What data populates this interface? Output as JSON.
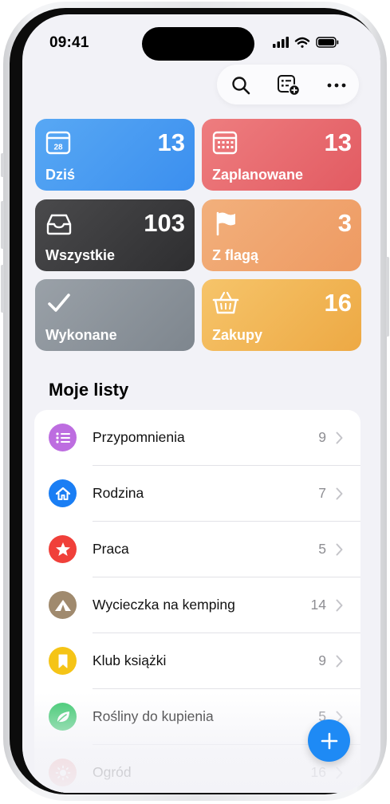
{
  "status_bar": {
    "time": "09:41"
  },
  "toolbar": {
    "icons": [
      "search-icon",
      "list-add-icon",
      "more-icon"
    ]
  },
  "smart_lists": [
    {
      "id": "today",
      "label": "Dziś",
      "count": "13",
      "icon": "calendar-icon",
      "calendar_day": "28",
      "color": "#3b94f0"
    },
    {
      "id": "scheduled",
      "label": "Zaplanowane",
      "count": "13",
      "icon": "calendar-grid-icon",
      "color": "#e9696d"
    },
    {
      "id": "all",
      "label": "Wszystkie",
      "count": "103",
      "icon": "tray-icon",
      "color": "#3a3a3c"
    },
    {
      "id": "flagged",
      "label": "Z flagą",
      "count": "3",
      "icon": "flag-icon",
      "color": "#f0a36a"
    },
    {
      "id": "completed",
      "label": "Wykonane",
      "count": "",
      "icon": "checkmark-icon",
      "color": "#8e959c"
    },
    {
      "id": "shopping",
      "label": "Zakupy",
      "count": "16",
      "icon": "basket-icon",
      "color": "#f2b652"
    }
  ],
  "my_lists": {
    "title": "Moje listy",
    "items": [
      {
        "name": "Przypomnienia",
        "count": "9",
        "icon": "list-icon",
        "color": "#bd6de0"
      },
      {
        "name": "Rodzina",
        "count": "7",
        "icon": "house-icon",
        "color": "#1a7ef4"
      },
      {
        "name": "Praca",
        "count": "5",
        "icon": "star-icon",
        "color": "#f0403a"
      },
      {
        "name": "Wycieczka na kemping",
        "count": "14",
        "icon": "tent-icon",
        "color": "#a08a6e"
      },
      {
        "name": "Klub książki",
        "count": "9",
        "icon": "bookmark-icon",
        "color": "#f5c417"
      },
      {
        "name": "Rośliny do kupienia",
        "count": "5",
        "icon": "leaf-icon",
        "color": "#37c76a"
      },
      {
        "name": "Ogród",
        "count": "16",
        "icon": "sun-icon",
        "color": "#f0a0a0"
      }
    ]
  },
  "fab": {
    "icon": "plus-icon",
    "color": "#1e8af5"
  }
}
